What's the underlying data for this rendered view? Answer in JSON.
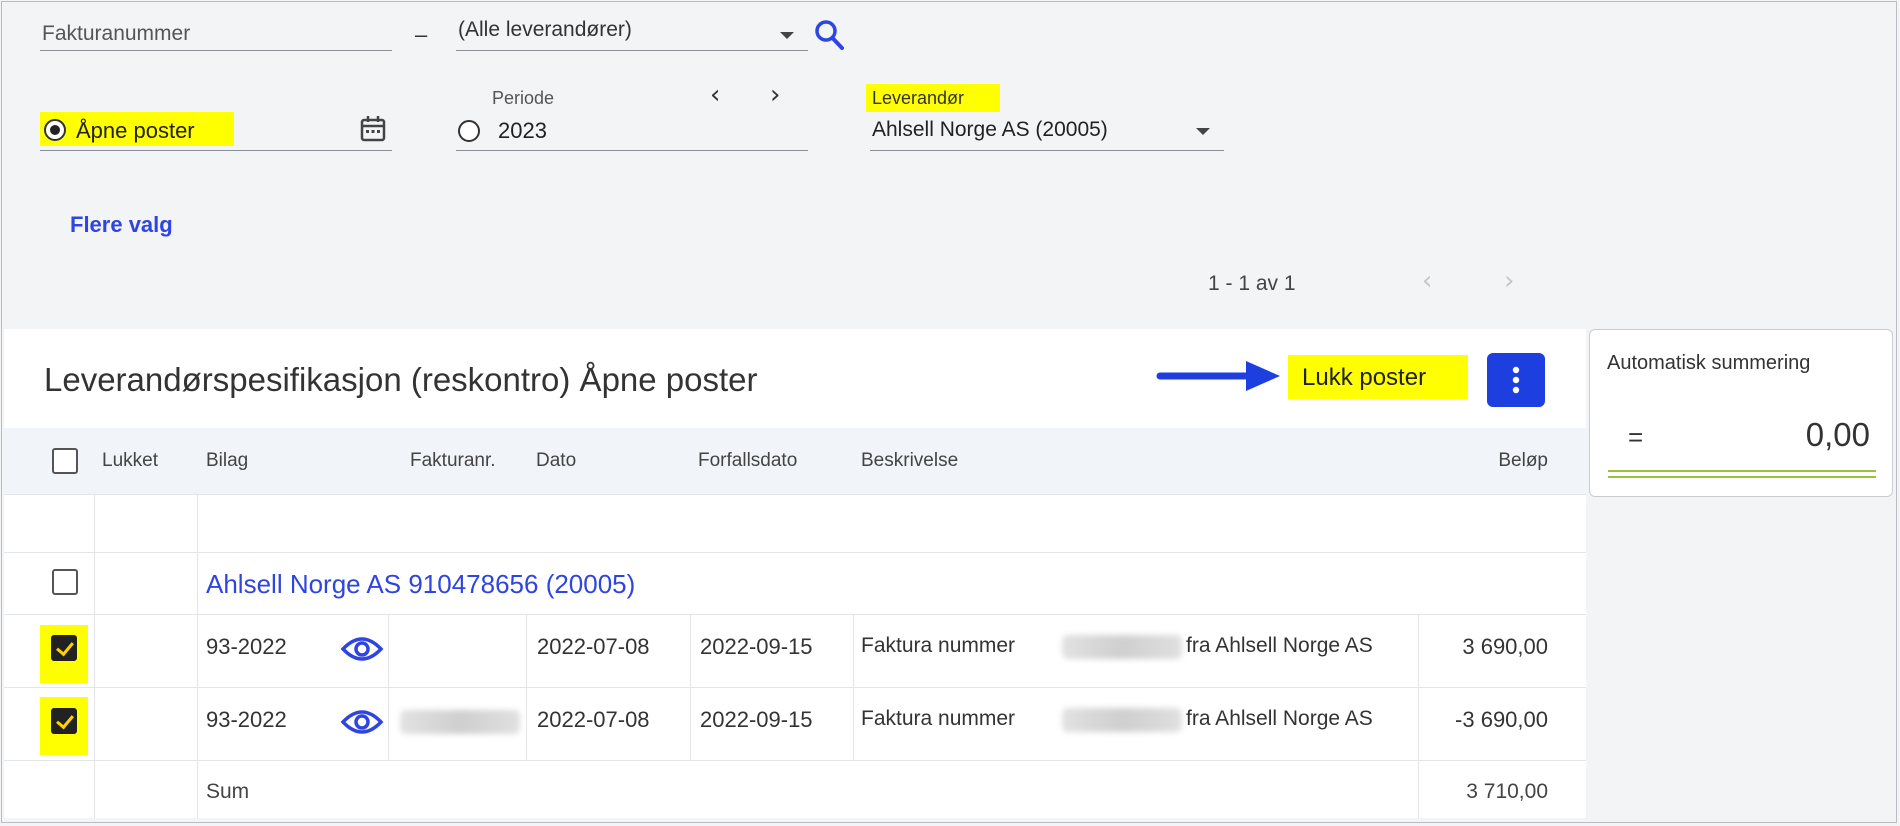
{
  "filters": {
    "invoice_placeholder": "Fakturanummer",
    "dash": "–",
    "supplier_scope": "(Alle leverandører)",
    "open_items_label": "Åpne poster",
    "period_label": "Periode",
    "period_value": "2023",
    "supplier_label": "Leverandør",
    "supplier_value": "Ahlsell Norge AS (20005)",
    "more_options": "Flere valg"
  },
  "pagination": {
    "text": "1 - 1 av 1"
  },
  "panel": {
    "title": "Leverandørspesifikasjon (reskontro) Åpne poster",
    "close_items_button": "Lukk poster"
  },
  "table": {
    "headers": {
      "lukket": "Lukket",
      "bilag": "Bilag",
      "fakturanr": "Fakturanr.",
      "dato": "Dato",
      "forfallsdato": "Forfallsdato",
      "beskrivelse": "Beskrivelse",
      "belop": "Beløp"
    },
    "group_title": "Ahlsell Norge AS 910478656 (20005)",
    "rows": [
      {
        "bilag": "93-2022",
        "dato": "2022-07-08",
        "forfall": "2022-09-15",
        "desc_prefix": "Faktura nummer",
        "desc_suffix": "fra Ahlsell Norge AS",
        "belop": "3 690,00",
        "checked": true
      },
      {
        "bilag": "93-2022",
        "dato": "2022-07-08",
        "forfall": "2022-09-15",
        "desc_prefix": "Faktura nummer",
        "desc_suffix": "fra Ahlsell Norge AS",
        "belop": "-3 690,00",
        "checked": true
      }
    ],
    "sum_label": "Sum",
    "sum_value": "3 710,00"
  },
  "summary": {
    "title": "Automatisk summering",
    "equals": "=",
    "value": "0,00"
  },
  "colors": {
    "accent_blue": "#2f45e0",
    "highlight": "#ffff00",
    "sum_underline": "#9ac33a"
  },
  "icons": [
    "search-icon",
    "calendar-icon",
    "chevron-left-icon",
    "chevron-right-icon",
    "kebab-menu-icon",
    "eye-icon",
    "arrow-right-icon",
    "dropdown-arrow-icon"
  ]
}
